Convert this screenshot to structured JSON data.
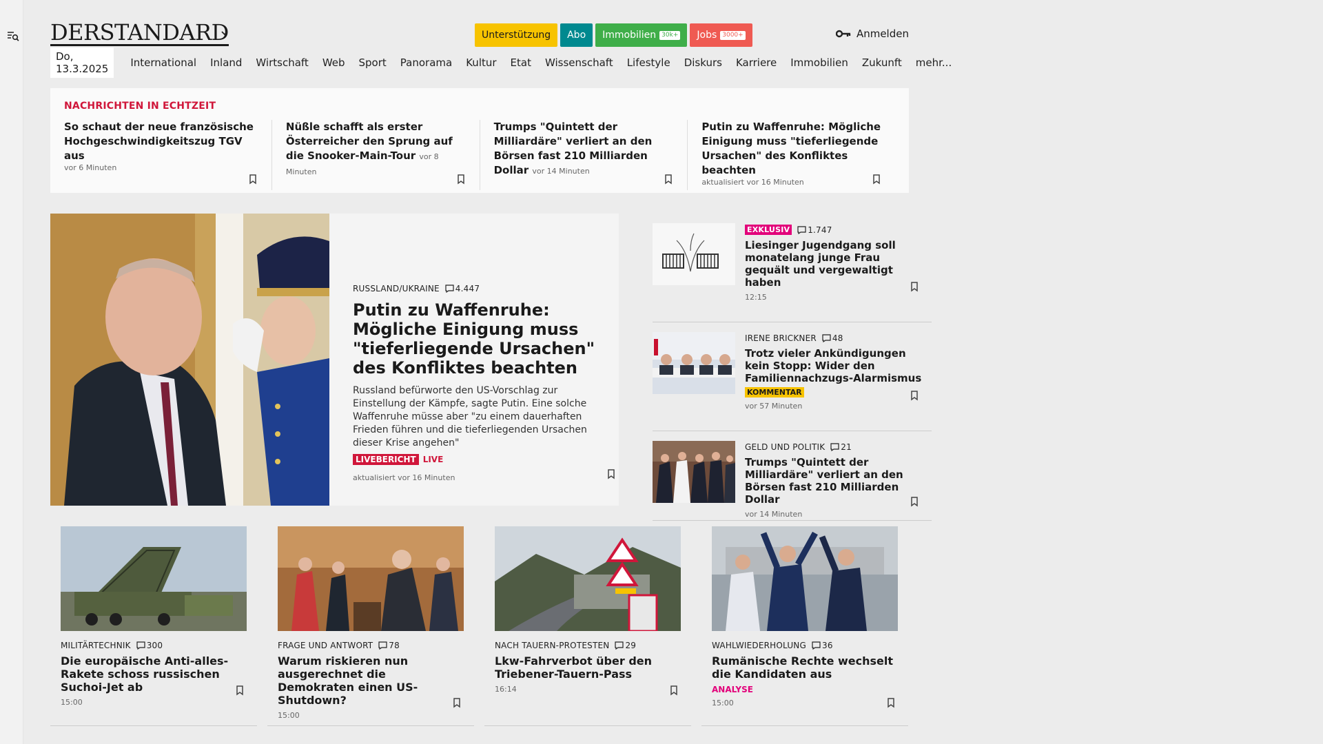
{
  "header": {
    "logo_text": "DERSTANDARD",
    "pills": [
      {
        "label": "Unterstützung",
        "bg": "#f7c300",
        "fg": "#1a1a1a",
        "tag": ""
      },
      {
        "label": "Abo",
        "bg": "#00898f",
        "fg": "#ffffff",
        "tag": ""
      },
      {
        "label": "Immobilien",
        "bg": "#3fae49",
        "fg": "#ffffff",
        "tag": "30k+"
      },
      {
        "label": "Jobs",
        "bg": "#ef5a52",
        "fg": "#ffffff",
        "tag": "3000+"
      }
    ],
    "login_label": "Anmelden"
  },
  "nav": {
    "date": "Do, 13.3.2025",
    "items": [
      "International",
      "Inland",
      "Wirtschaft",
      "Web",
      "Sport",
      "Panorama",
      "Kultur",
      "Etat",
      "Wissenschaft",
      "Lifestyle",
      "Diskurs",
      "Karriere",
      "Immobilien",
      "Zukunft",
      "mehr..."
    ]
  },
  "realtime": {
    "heading": "NACHRICHTEN IN ECHTZEIT",
    "items": [
      {
        "title": "So schaut der neue französische Hochgeschwindigkeitszug TGV aus",
        "time": "vor 6 Minuten"
      },
      {
        "title": "Nüßle schafft als erster Österreicher den Sprung auf die Snooker-Main-Tour",
        "time": "vor 8 Minuten"
      },
      {
        "title": "Trumps \"Quintett der Milliardäre\" verliert an den Börsen fast 210 Milliarden Dollar",
        "time": "vor 14 Minuten"
      },
      {
        "title": "Putin zu Waffenruhe: Mögliche Einigung muss \"tieferliegende Ursachen\" des Konfliktes beachten",
        "time": "aktualisiert vor 16 Minuten"
      }
    ]
  },
  "lead": {
    "kicker": "RUSSLAND/UKRAINE",
    "comments": "4.447",
    "title": "Putin zu Waffenruhe: Mögliche Einigung muss \"tieferliegende Ursachen\" des Konfliktes beachten",
    "teaser": "Russland befürworte den US-Vorschlag zur Einstellung der Kämpfe, sagte Putin. Eine solche Waffenruhe müsse aber \"zu einem dauerhaften Frieden führen und die tieferliegenden Ursachen dieser Krise angehen\"",
    "badge": "LIVEBERICHT",
    "live": "LIVE",
    "meta": "aktualisiert vor 16 Minuten"
  },
  "side": [
    {
      "badge": "EXKLUSIV",
      "kicker": "",
      "comments": "1.747",
      "title": "Liesinger Jugendgang soll monatelang junge Frau gequält und vergewaltigt haben",
      "time": "12:15",
      "label": ""
    },
    {
      "badge": "",
      "kicker": "IRENE BRICKNER",
      "comments": "48",
      "title": "Trotz vieler Ankündigungen kein Stopp: Wider den Familiennachzugs-Alarmismus",
      "time": "vor 57 Minuten",
      "label": "KOMMENTAR"
    },
    {
      "badge": "",
      "kicker": "GELD UND POLITIK",
      "comments": "21",
      "title": "Trumps \"Quintett der Milliardäre\" verliert an den Börsen fast 210 Milliarden Dollar",
      "time": "vor 14 Minuten",
      "label": ""
    }
  ],
  "cards": [
    {
      "kicker": "MILITÄRTECHNIK",
      "comments": "300",
      "title": "Die europäische Anti-alles-Rakete schoss russischen Suchoi-Jet ab",
      "time": "15:00",
      "label": ""
    },
    {
      "kicker": "FRAGE UND ANTWORT",
      "comments": "78",
      "title": "Warum riskieren nun ausgerechnet die Demokraten einen US-Shutdown?",
      "time": "15:00",
      "label": ""
    },
    {
      "kicker": "NACH TAUERN-PROTESTEN",
      "comments": "29",
      "title": "Lkw-Fahrverbot über den Triebener-Tauern-Pass",
      "time": "16:14",
      "label": ""
    },
    {
      "kicker": "WAHLWIEDERHOLUNG",
      "comments": "36",
      "title": "Rumänische Rechte wechselt die Kandidaten aus",
      "time": "15:00",
      "label": "ANALYSE"
    }
  ],
  "icons": {
    "menu": "search-menu-icon",
    "chevron": "chevron-down-icon",
    "key": "key-icon",
    "bookmark": "bookmark-icon",
    "comment": "comment-icon"
  }
}
